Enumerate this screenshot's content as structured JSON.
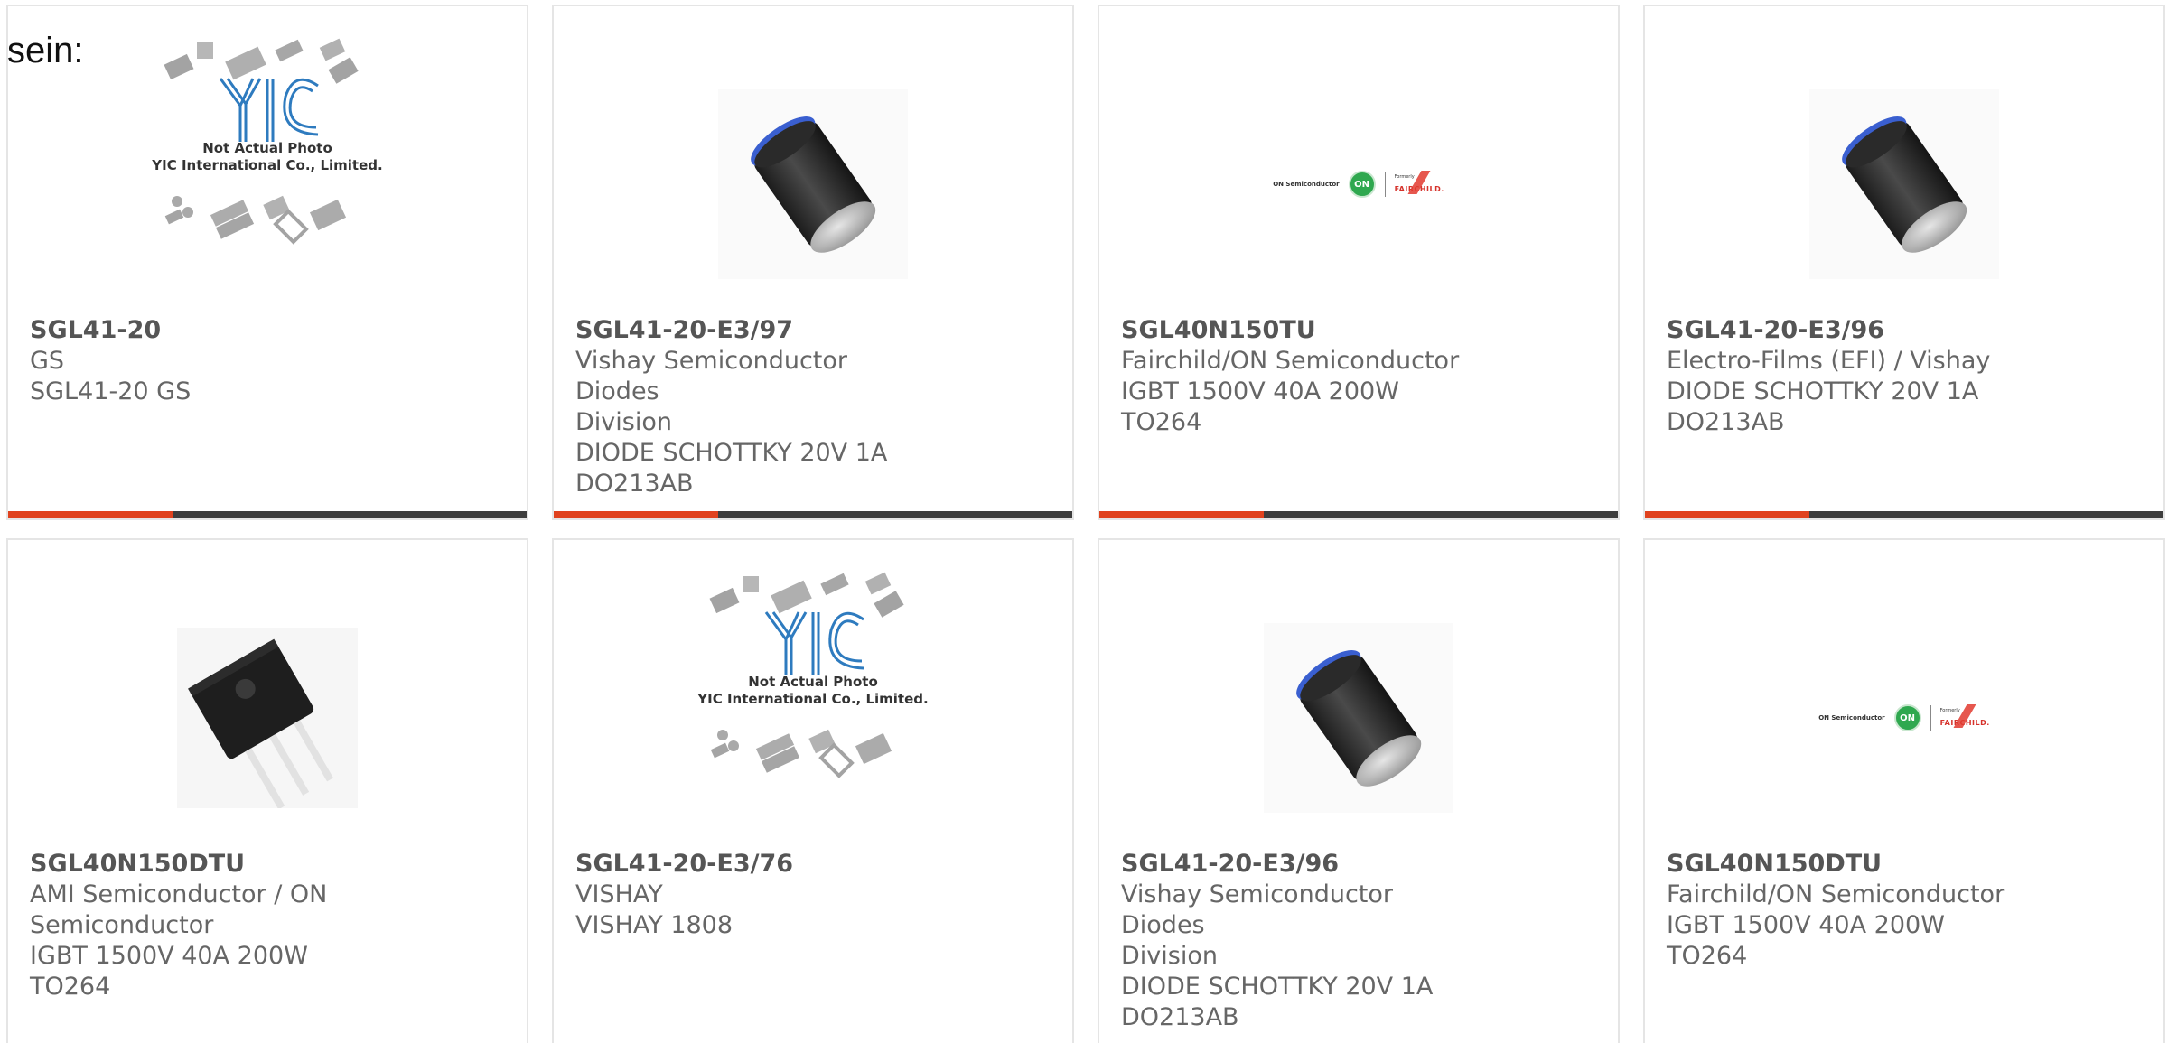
{
  "intro_text": "sein:",
  "colors": {
    "accent": "#e0421e",
    "bar": "#3d3d3d",
    "border": "#e5e5e5",
    "text": "#666666"
  },
  "cards": [
    {
      "part": "SGL41-20",
      "lines": [
        "GS",
        "SGL41-20 GS"
      ],
      "image": "yic-placeholder-icon",
      "img_text1": "Not Actual Photo",
      "img_text2": "YIC International Co., Limited."
    },
    {
      "part": "SGL41-20-E3/97",
      "lines": [
        "Vishay Semiconductor Diodes",
        "Division",
        "DIODE SCHOTTKY 20V 1A",
        "DO213AB"
      ],
      "image": "diode-icon"
    },
    {
      "part": "SGL40N150TU",
      "lines": [
        "Fairchild/ON Semiconductor",
        "IGBT 1500V 40A 200W TO264"
      ],
      "image": "onsemi-fairchild-logo-icon"
    },
    {
      "part": "SGL41-20-E3/96",
      "lines": [
        "Electro-Films (EFI) / Vishay",
        "DIODE SCHOTTKY 20V 1A",
        "DO213AB"
      ],
      "image": "diode-icon"
    },
    {
      "part": "SGL40N150DTU",
      "lines": [
        "AMI Semiconductor / ON",
        "Semiconductor",
        "IGBT 1500V 40A 200W TO264"
      ],
      "image": "to264-package-icon"
    },
    {
      "part": "SGL41-20-E3/76",
      "lines": [
        "VISHAY",
        "VISHAY 1808"
      ],
      "image": "yic-placeholder-icon",
      "img_text1": "Not Actual Photo",
      "img_text2": "YIC International Co., Limited."
    },
    {
      "part": "SGL41-20-E3/96",
      "lines": [
        "Vishay Semiconductor Diodes",
        "Division",
        "DIODE SCHOTTKY 20V 1A",
        "DO213AB"
      ],
      "image": "diode-icon"
    },
    {
      "part": "SGL40N150DTU",
      "lines": [
        "Fairchild/ON Semiconductor",
        "IGBT 1500V 40A 200W TO264"
      ],
      "image": "onsemi-fairchild-logo-icon"
    }
  ],
  "logo": {
    "onsemi_label": "ON Semiconductor",
    "on_badge": "ON",
    "formerly": "Formerly",
    "fairchild": "FAIRCHILD."
  }
}
